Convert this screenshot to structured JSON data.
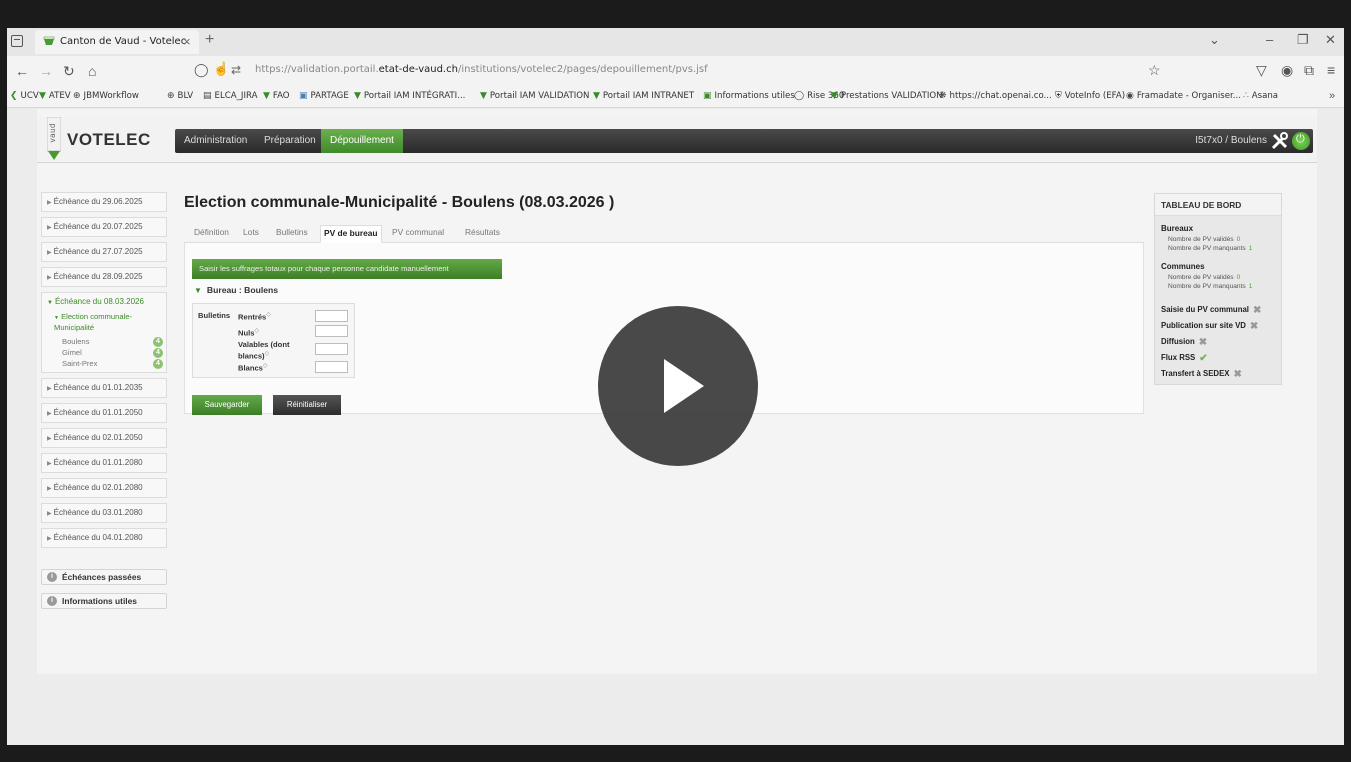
{
  "browser": {
    "tab_title": "Canton de Vaud - Votelec",
    "tab_close": "×",
    "new_tab": "+",
    "url_prefix": "https://validation.portail.",
    "url_domain": "etat-de-vaud.ch",
    "url_path": "/institutions/votelec2/pages/depouillement/pvs.jsf",
    "bookmarks": [
      "UCV",
      "ATEV",
      "JBMWorkflow",
      "BLV",
      "ELCA_JIRA",
      "FAO",
      "PARTAGE",
      "Portail IAM INTÉGRATI...",
      "Portail IAM VALIDATION",
      "Portail IAM INTRANET",
      "Informations utiles",
      "Rise 360",
      "Prestations VALIDATION",
      "https://chat.openai.co...",
      "VoteInfo (EFA)",
      "Framadate - Organiser...",
      "Asana"
    ],
    "bookmarks_more": "»"
  },
  "app": {
    "logo_vaud": "vaud",
    "logo_text": "VOTELEC",
    "nav": [
      "Administration",
      "Préparation",
      "Dépouillement"
    ],
    "user": "I5t7x0  /  Boulens"
  },
  "sidebar": {
    "items_before": [
      "Échéance du 29.06.2025",
      "Échéance du 20.07.2025",
      "Échéance du 27.07.2025",
      "Échéance du 28.09.2025"
    ],
    "open_group": {
      "label": "Échéance du 08.03.2026",
      "election": "Election communale-Municipalité",
      "communes": [
        {
          "name": "Boulens",
          "count": "4"
        },
        {
          "name": "Gimel",
          "count": "4"
        },
        {
          "name": "Saint-Prex",
          "count": "4"
        }
      ]
    },
    "items_after": [
      "Échéance du 01.01.2035",
      "Échéance du 01.01.2050",
      "Échéance du 02.01.2050",
      "Échéance du 01.01.2080",
      "Échéance du 02.01.2080",
      "Échéance du 03.01.2080",
      "Échéance du 04.01.2080"
    ],
    "extras": [
      "Échéances passées",
      "Informations utiles"
    ]
  },
  "main": {
    "title": "Election communale-Municipalité - Boulens (08.03.2026 )",
    "tabs": [
      "Définition",
      "Lots",
      "Bulletins",
      "PV de bureau",
      "PV communal",
      "Résultats"
    ],
    "active_tab": "PV de bureau",
    "manual_button": "Saisir les suffrages totaux pour chaque personne candidate manuellement",
    "bureau_heading": "Bureau : Boulens",
    "bulletins_label": "Bulletins",
    "fields": [
      {
        "label": "Rentrés",
        "value": ""
      },
      {
        "label": "Nuls",
        "value": ""
      },
      {
        "label": "Valables (dont blancs)",
        "value": ""
      },
      {
        "label": "Blancs",
        "value": ""
      }
    ],
    "save_button": "Sauvegarder",
    "reset_button": "Réinitialiser"
  },
  "dashboard": {
    "title": "TABLEAU DE BORD",
    "bureaux": {
      "label": "Bureaux",
      "validated_label": "Nombre de PV validés",
      "validated": "0",
      "missing_label": "Nombre de PV manquants",
      "missing": "1"
    },
    "communes": {
      "label": "Communes",
      "validated_label": "Nombre de PV validés",
      "validated": "0",
      "missing_label": "Nombre de PV manquants",
      "missing": "1"
    },
    "actions": [
      {
        "label": "Saisie du PV communal",
        "status": "x"
      },
      {
        "label": "Publication sur site VD",
        "status": "x"
      },
      {
        "label": "Diffusion",
        "status": "x"
      },
      {
        "label": "Flux RSS",
        "status": "check"
      },
      {
        "label": "Transfert à SEDEX",
        "status": "x"
      }
    ]
  },
  "colors": {
    "accent_green": "#4a9a32",
    "nav_dark": "#2f2f2f"
  }
}
